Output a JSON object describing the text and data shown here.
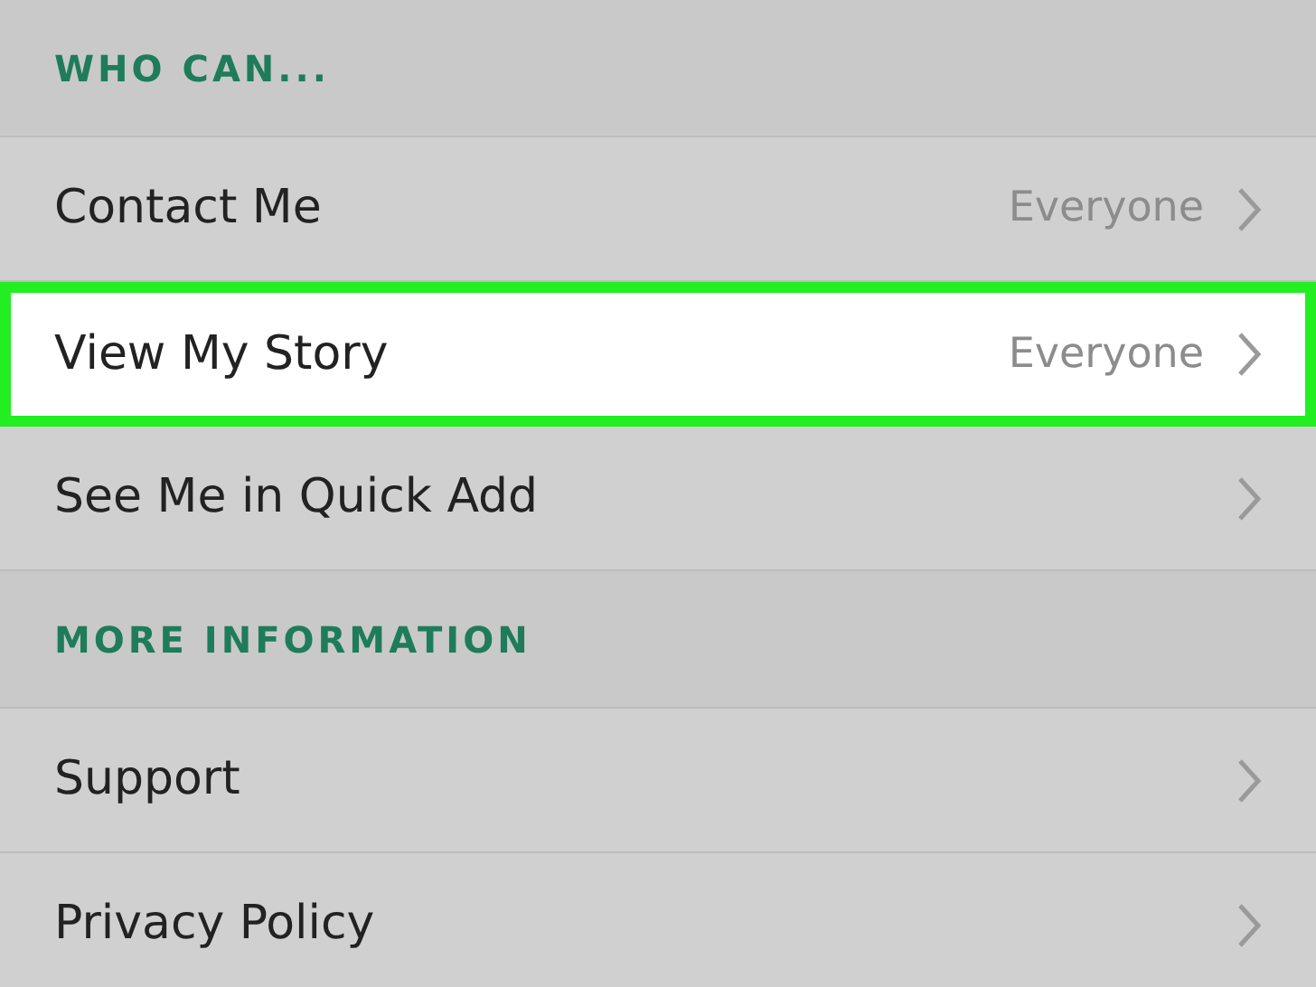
{
  "sections": [
    {
      "header": "WHO CAN...",
      "rows": [
        {
          "label": "Contact Me",
          "value": "Everyone",
          "highlighted": false
        },
        {
          "label": "View My Story",
          "value": "Everyone",
          "highlighted": true
        },
        {
          "label": "See Me in Quick Add",
          "highlighted": false
        }
      ]
    },
    {
      "header": "MORE INFORMATION",
      "rows": [
        {
          "label": "Support",
          "highlighted": false
        },
        {
          "label": "Privacy Policy",
          "highlighted": false
        }
      ]
    }
  ]
}
